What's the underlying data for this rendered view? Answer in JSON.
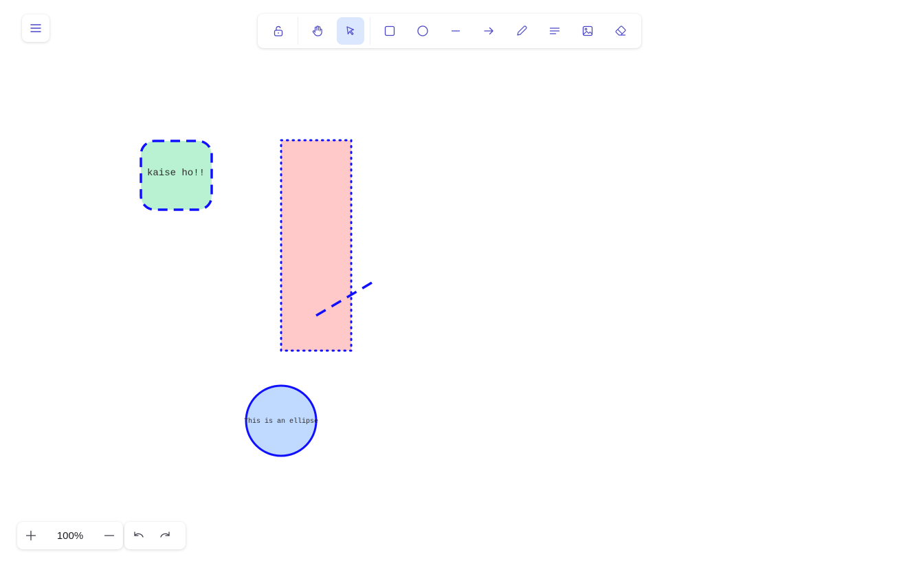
{
  "app": {
    "menu_icon": "hamburger-menu-icon",
    "accent_color": "#dbe6ff",
    "icon_color": "#4b46c8"
  },
  "toolbar": {
    "tools": [
      {
        "name": "lock",
        "icon": "unlock-icon",
        "active": false
      },
      {
        "name": "hand",
        "icon": "hand-icon",
        "active": false
      },
      {
        "name": "select",
        "icon": "pointer-icon",
        "active": true
      },
      {
        "name": "rectangle",
        "icon": "square-icon",
        "active": false
      },
      {
        "name": "ellipse",
        "icon": "circle-icon",
        "active": false
      },
      {
        "name": "line",
        "icon": "line-icon",
        "active": false
      },
      {
        "name": "arrow",
        "icon": "arrow-right-icon",
        "active": false
      },
      {
        "name": "pencil",
        "icon": "pencil-icon",
        "active": false
      },
      {
        "name": "text",
        "icon": "text-lines-icon",
        "active": false
      },
      {
        "name": "image",
        "icon": "image-icon",
        "active": false
      },
      {
        "name": "eraser",
        "icon": "eraser-icon",
        "active": false
      }
    ]
  },
  "canvas": {
    "shapes": [
      {
        "type": "rounded-rectangle",
        "text": "kaise ho!!",
        "fill": "#b9f2d2",
        "stroke": "#1010ff",
        "stroke_style": "dashed"
      },
      {
        "type": "rectangle",
        "text": "",
        "fill": "#ffc9c9",
        "stroke": "#1010ff",
        "stroke_style": "dotted"
      },
      {
        "type": "line",
        "text": "",
        "stroke": "#1010ff",
        "stroke_style": "dashed"
      },
      {
        "type": "ellipse",
        "text": "This is an ellipse",
        "fill": "#bfd9ff",
        "stroke": "#1010ff",
        "stroke_style": "solid"
      }
    ]
  },
  "zoom": {
    "zoom_in_icon": "plus-icon",
    "zoom_out_icon": "minus-icon",
    "value": "100%"
  },
  "history": {
    "undo_icon": "undo-icon",
    "redo_icon": "redo-icon"
  }
}
